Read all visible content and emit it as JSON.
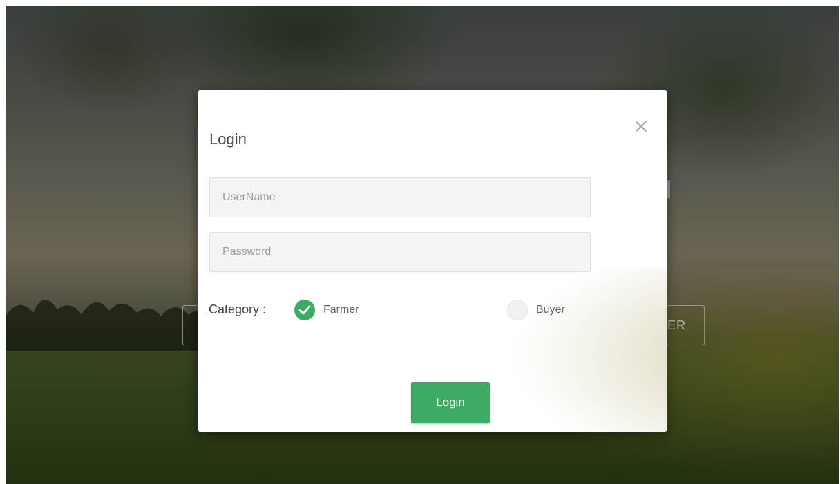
{
  "background": {
    "partial_button_text": "ER"
  },
  "modal": {
    "title": "Login",
    "close_icon": "close-icon",
    "username": {
      "value": "",
      "placeholder": "UserName"
    },
    "password": {
      "value": "",
      "placeholder": "Password"
    },
    "category": {
      "label": "Category :",
      "options": [
        {
          "label": "Farmer",
          "selected": true
        },
        {
          "label": "Buyer",
          "selected": false
        }
      ]
    },
    "submit_label": "Login"
  },
  "colors": {
    "accent": "#3daa66",
    "input_bg": "#f4f4f4"
  }
}
